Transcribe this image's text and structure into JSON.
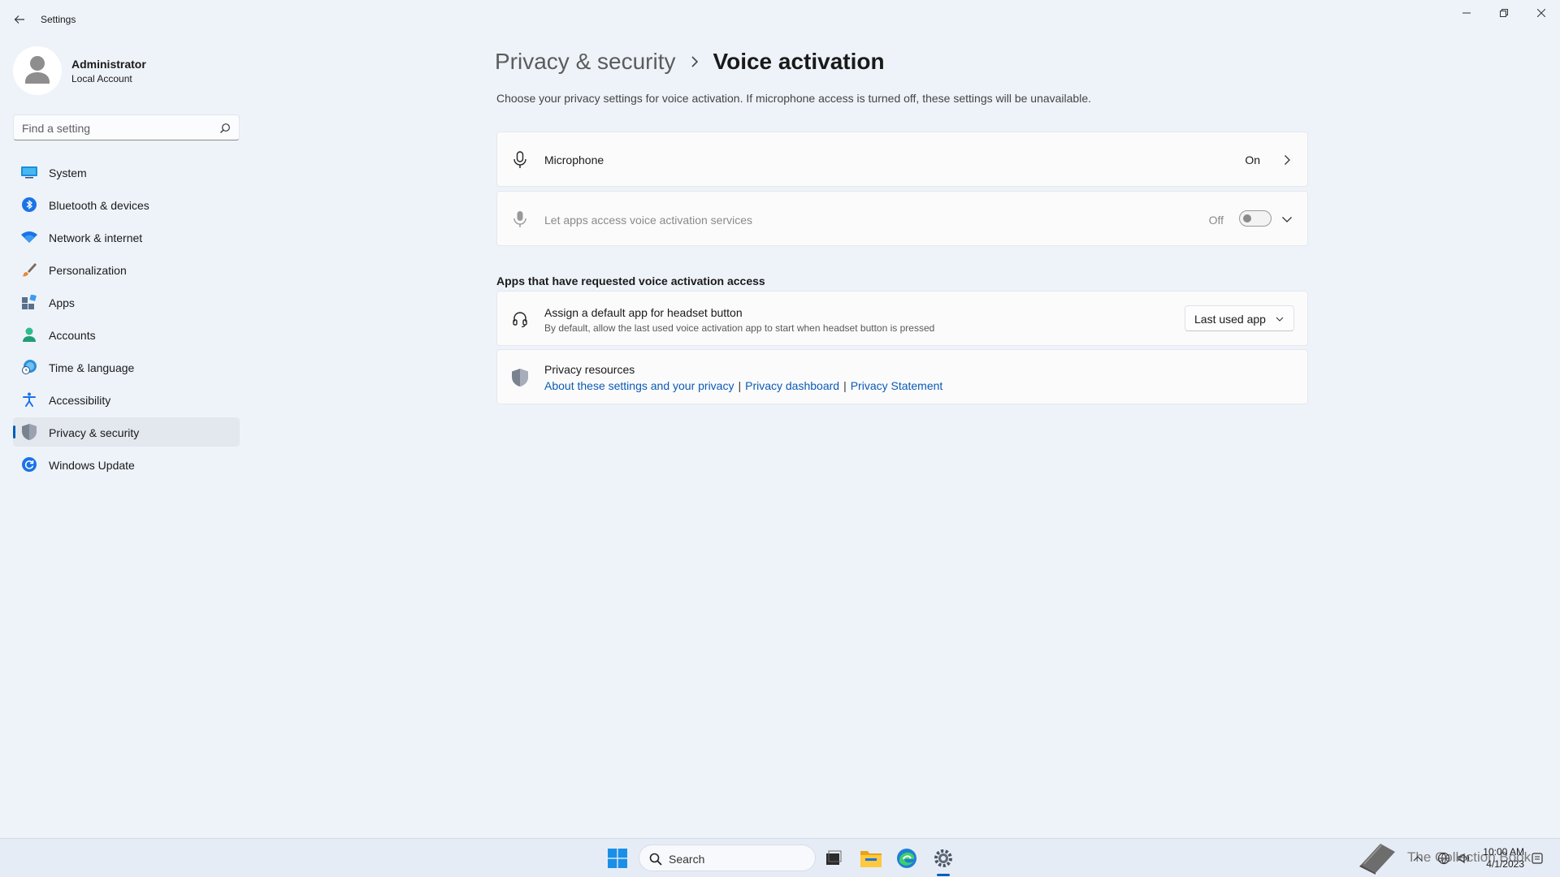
{
  "window": {
    "title": "Settings"
  },
  "profile": {
    "name": "Administrator",
    "account_type": "Local Account"
  },
  "search": {
    "placeholder": "Find a setting"
  },
  "sidebar": {
    "items": [
      {
        "label": "System",
        "icon": "monitor-icon",
        "color": "#1a8fd8"
      },
      {
        "label": "Bluetooth & devices",
        "icon": "bluetooth-icon",
        "color": "#1a73e8"
      },
      {
        "label": "Network & internet",
        "icon": "wifi-icon",
        "color": "#1a73e8"
      },
      {
        "label": "Personalization",
        "icon": "brush-icon",
        "color": "#d9832b"
      },
      {
        "label": "Apps",
        "icon": "apps-icon",
        "color": "#5a6f8a"
      },
      {
        "label": "Accounts",
        "icon": "person-icon",
        "color": "#2ebd8c"
      },
      {
        "label": "Time & language",
        "icon": "globe-clock-icon",
        "color": "#2e8fd8"
      },
      {
        "label": "Accessibility",
        "icon": "accessibility-icon",
        "color": "#1a73e8"
      },
      {
        "label": "Privacy & security",
        "icon": "shield-icon",
        "color": "#7a8290",
        "active": true
      },
      {
        "label": "Windows Update",
        "icon": "refresh-icon",
        "color": "#1a73e8"
      }
    ]
  },
  "main": {
    "breadcrumb_parent": "Privacy & security",
    "breadcrumb_current": "Voice activation",
    "description": "Choose your privacy settings for voice activation. If microphone access is turned off, these settings will be unavailable.",
    "microphone": {
      "label": "Microphone",
      "value": "On"
    },
    "let_apps": {
      "label": "Let apps access voice activation services",
      "value": "Off",
      "toggle_on": false
    },
    "section_title": "Apps that have requested voice activation access",
    "headset": {
      "title": "Assign a default app for headset button",
      "subtitle": "By default, allow the last used voice activation app to start when headset button is pressed",
      "dropdown_value": "Last used app"
    },
    "resources": {
      "title": "Privacy resources",
      "links": [
        "About these settings and your privacy",
        "Privacy dashboard",
        "Privacy Statement"
      ],
      "separator": "|"
    }
  },
  "taskbar": {
    "search_label": "Search",
    "tray_text": "The Collection Book",
    "time": "10:00 AM",
    "date": "4/1/2023",
    "accent": "#005fb8"
  }
}
